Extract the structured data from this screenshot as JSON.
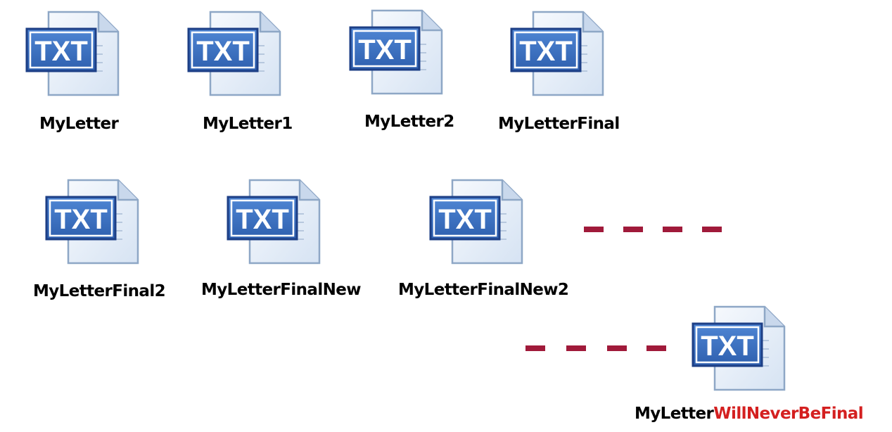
{
  "icon": {
    "badge_text": "TXT",
    "name": "txt-file-icon"
  },
  "files": [
    {
      "label": "MyLetter"
    },
    {
      "label": "MyLetter1"
    },
    {
      "label": "MyLetter2"
    },
    {
      "label": "MyLetterFinal"
    },
    {
      "label": "MyLetterFinal2"
    },
    {
      "label": "MyLetterFinalNew"
    },
    {
      "label": "MyLetterFinalNew2"
    },
    {
      "label_prefix": "MyLetter",
      "label_suffix": "WillNeverBeFinal"
    }
  ],
  "colors": {
    "badge_fill": "#3a6fbf",
    "badge_border": "#1d3f86",
    "badge_text": "#ffffff",
    "page_fill": "#e4edf8",
    "page_border": "#8ea7c6",
    "dash": "#a01a3a",
    "label": "#000000",
    "accent_label": "#d42020"
  }
}
